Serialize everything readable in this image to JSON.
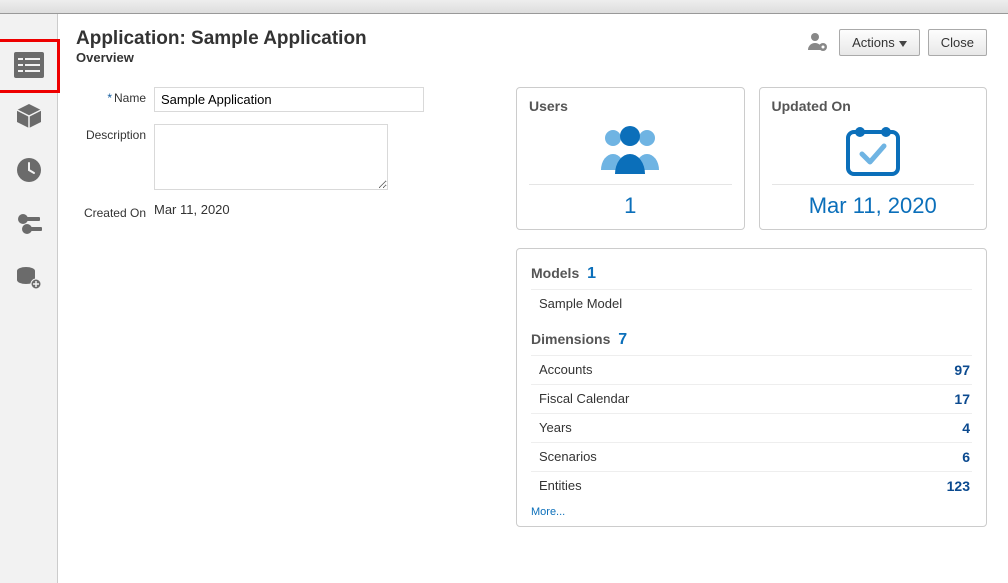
{
  "header": {
    "title": "Application: Sample Application",
    "subtitle": "Overview",
    "actions_label": "Actions",
    "close_label": "Close"
  },
  "form": {
    "name_label": "Name",
    "name_value": "Sample Application",
    "description_label": "Description",
    "description_value": "",
    "created_on_label": "Created On",
    "created_on_value": "Mar 11, 2020"
  },
  "cards": {
    "users": {
      "title": "Users",
      "value": "1"
    },
    "updated": {
      "title": "Updated On",
      "value": "Mar 11, 2020"
    }
  },
  "panel": {
    "models_label": "Models",
    "models_count": "1",
    "models_items": [
      {
        "name": "Sample Model"
      }
    ],
    "dimensions_label": "Dimensions",
    "dimensions_count": "7",
    "dimensions_items": [
      {
        "name": "Accounts",
        "count": "97"
      },
      {
        "name": "Fiscal Calendar",
        "count": "17"
      },
      {
        "name": "Years",
        "count": "4"
      },
      {
        "name": "Scenarios",
        "count": "6"
      },
      {
        "name": "Entities",
        "count": "123"
      }
    ],
    "more_label": "More..."
  },
  "sidebar": {
    "items": [
      {
        "name": "overview",
        "label": "Overview"
      },
      {
        "name": "cube",
        "label": "Models"
      },
      {
        "name": "history",
        "label": "History"
      },
      {
        "name": "keys",
        "label": "Permissions"
      },
      {
        "name": "data",
        "label": "Data"
      }
    ]
  }
}
